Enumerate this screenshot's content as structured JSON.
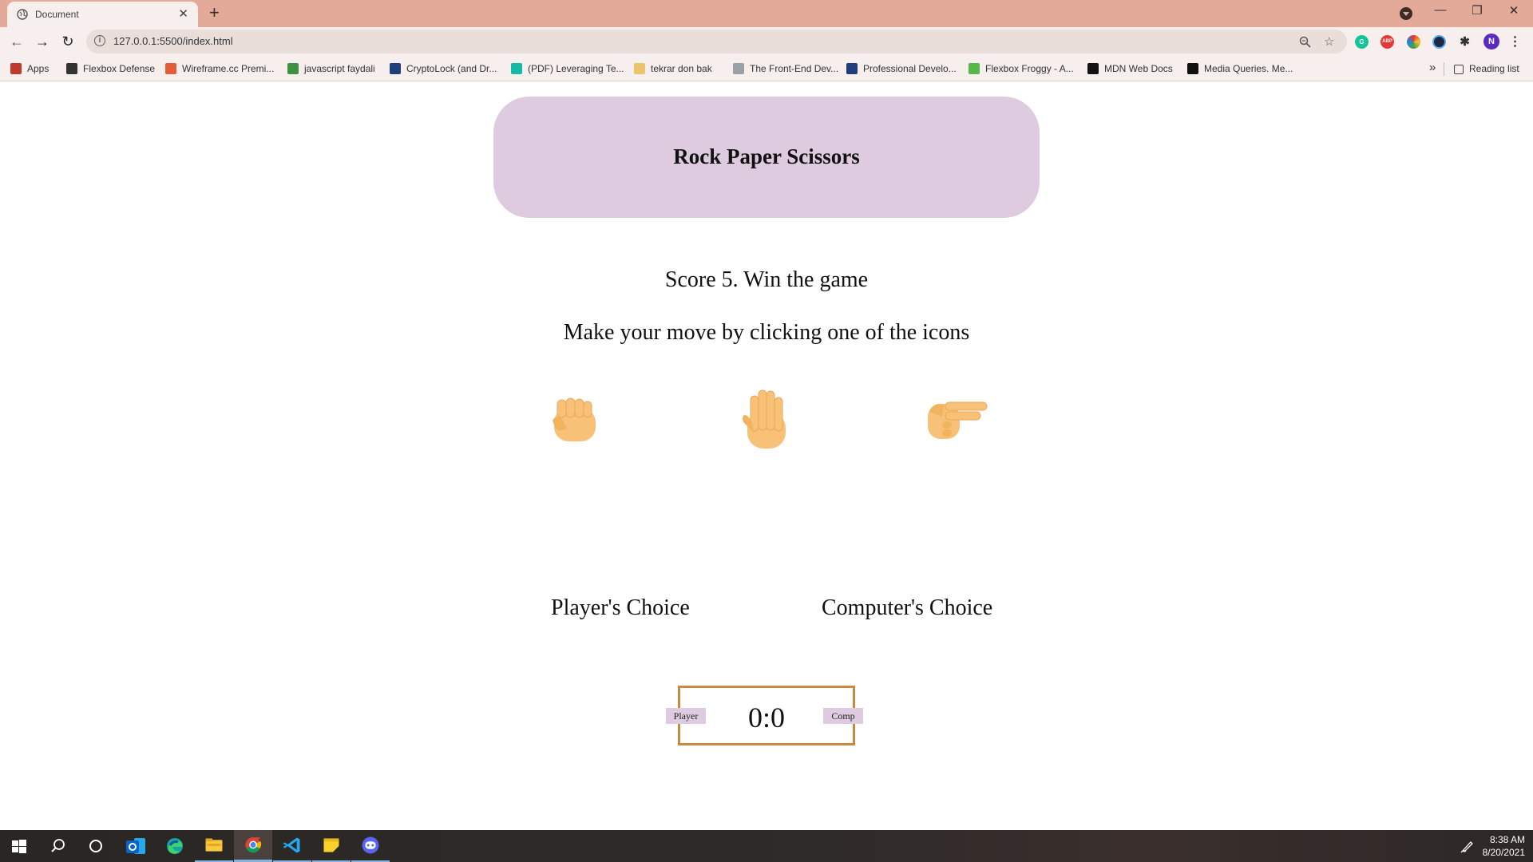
{
  "browser": {
    "tab_title": "Document",
    "tab_close": "✕",
    "new_tab": "+",
    "url": "127.0.0.1:5500/index.html",
    "window_controls": {
      "minimize": "—",
      "restore": "❐",
      "close": "✕"
    },
    "bookmarks": [
      {
        "label": "Apps",
        "icon": "apps-grid-icon",
        "color": "#c0392b"
      },
      {
        "label": "Flexbox Defense",
        "icon": "hash-icon",
        "color": "#333333"
      },
      {
        "label": "Wireframe.cc Premi...",
        "icon": "wireframe-icon",
        "color": "#e45d3b"
      },
      {
        "label": "javascript faydali",
        "icon": "bookmark-green-icon",
        "color": "#3f9142"
      },
      {
        "label": "CryptoLock (and Dr...",
        "icon": "ieee-icon",
        "color": "#1e3f7a"
      },
      {
        "label": "(PDF) Leveraging Te...",
        "icon": "researchgate-icon",
        "color": "#17b8a6"
      },
      {
        "label": "tekrar don bak",
        "icon": "crown-icon",
        "color": "#e9c46a"
      },
      {
        "label": "The Front-End Dev...",
        "icon": "dash-icon",
        "color": "#9aa0a6"
      },
      {
        "label": "Professional Develo...",
        "icon": "calendar-icon",
        "color": "#1e3f7a"
      },
      {
        "label": "Flexbox Froggy - A...",
        "icon": "frog-icon",
        "color": "#54b948"
      },
      {
        "label": "MDN Web Docs",
        "icon": "mdn-icon",
        "color": "#111111"
      },
      {
        "label": "Media Queries. Me...",
        "icon": "medium-icon",
        "color": "#111111"
      }
    ],
    "overflow": "»",
    "reading_list": "Reading list",
    "profile_initial": "N",
    "abp_label": "ABP"
  },
  "game": {
    "title": "Rock Paper Scissors",
    "subtitle": "Score 5. Win the game",
    "instruction": "Make your move by clicking one of the icons",
    "players_choice_label": "Player's Choice",
    "computers_choice_label": "Computer's Choice",
    "score": "0:0",
    "player_tag": "Player",
    "comp_tag": "Comp",
    "moves": [
      "rock",
      "paper",
      "scissors"
    ]
  },
  "taskbar": {
    "time": "8:38 AM",
    "date": "8/20/2021"
  },
  "colors": {
    "header_card": "#dfcbdf",
    "score_border": "#c98a3e",
    "hand_fill": "#f7c278",
    "tab_strip": "#e3a999"
  }
}
